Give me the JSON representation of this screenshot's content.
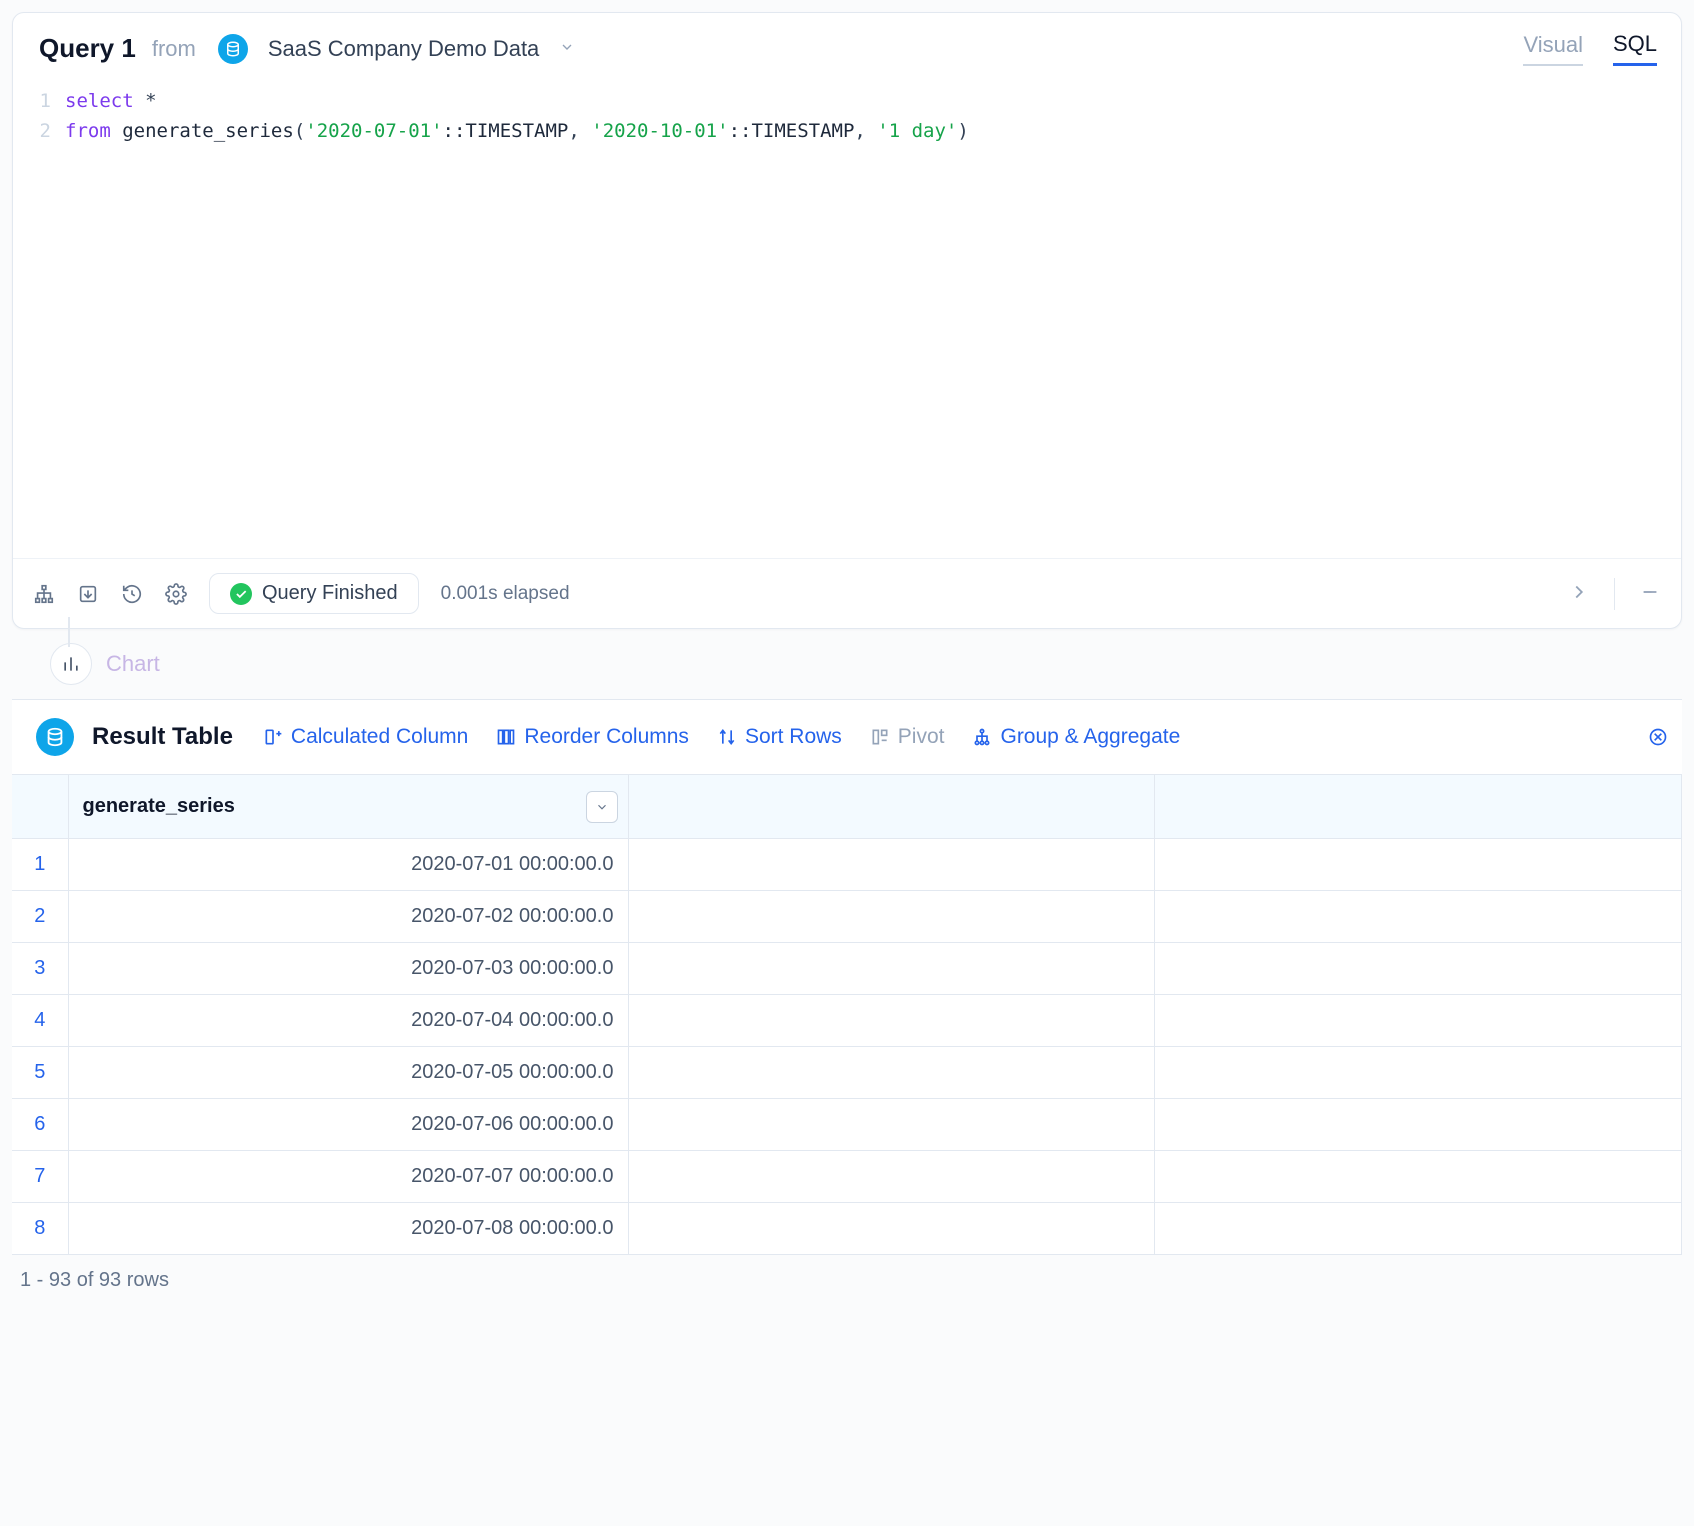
{
  "header": {
    "query_title": "Query 1",
    "from_label": "from",
    "datasource_name": "SaaS Company Demo Data",
    "tabs": {
      "visual": "Visual",
      "sql": "SQL",
      "active": "sql"
    }
  },
  "code": {
    "line_numbers": [
      "1",
      "2"
    ],
    "kw_select": "select",
    "star": "*",
    "kw_from": "from",
    "fn_name": "generate_series",
    "paren_open": "(",
    "str1": "'2020-07-01'",
    "cast1": "::TIMESTAMP",
    "comma1": ", ",
    "str2": "'2020-10-01'",
    "cast2": "::TIMESTAMP",
    "comma2": ", ",
    "str3": "'1 day'",
    "paren_close": ")"
  },
  "status": {
    "pill_label": "Query Finished",
    "elapsed": "0.001s elapsed"
  },
  "chart_row_label": "Chart",
  "result_header": {
    "title": "Result Table",
    "actions": {
      "calc_col": "Calculated Column",
      "reorder": "Reorder Columns",
      "sort": "Sort Rows",
      "pivot": "Pivot",
      "group": "Group & Aggregate"
    }
  },
  "table": {
    "column_header": "generate_series",
    "rows": [
      {
        "n": "1",
        "v": "2020-07-01 00:00:00.0"
      },
      {
        "n": "2",
        "v": "2020-07-02 00:00:00.0"
      },
      {
        "n": "3",
        "v": "2020-07-03 00:00:00.0"
      },
      {
        "n": "4",
        "v": "2020-07-04 00:00:00.0"
      },
      {
        "n": "5",
        "v": "2020-07-05 00:00:00.0"
      },
      {
        "n": "6",
        "v": "2020-07-06 00:00:00.0"
      },
      {
        "n": "7",
        "v": "2020-07-07 00:00:00.0"
      },
      {
        "n": "8",
        "v": "2020-07-08 00:00:00.0"
      }
    ]
  },
  "footer": "1 - 93 of 93 rows",
  "colors": {
    "accent": "#2563eb",
    "brand_teal": "#0ea5e9",
    "success": "#22c55e"
  }
}
